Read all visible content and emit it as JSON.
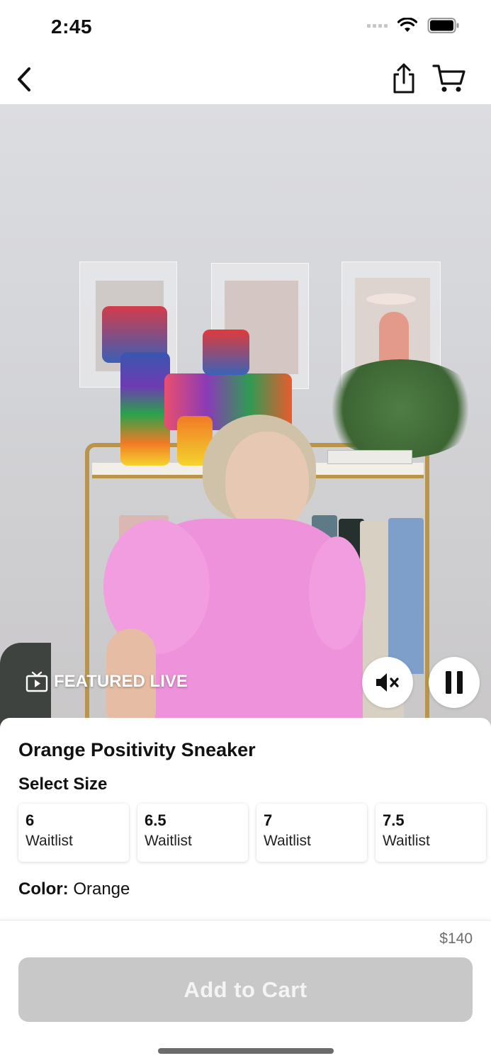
{
  "status_bar": {
    "time": "2:45",
    "icons": [
      "signal-icon",
      "wifi-icon",
      "battery-icon"
    ]
  },
  "nav": {
    "icons": [
      "back-chevron-icon",
      "share-icon",
      "cart-icon"
    ]
  },
  "video": {
    "badge_label": "FEATURED LIVE",
    "badge_icon": "tv-icon",
    "controls": [
      "mute-icon",
      "pause-icon"
    ]
  },
  "product": {
    "title": "Orange Positivity Sneaker",
    "select_size_label": "Select Size",
    "sizes": [
      {
        "size": "6",
        "status": "Waitlist"
      },
      {
        "size": "6.5",
        "status": "Waitlist"
      },
      {
        "size": "7",
        "status": "Waitlist"
      },
      {
        "size": "7.5",
        "status": "Waitlist"
      }
    ],
    "color_label": "Color:",
    "color_value": "Orange"
  },
  "footer": {
    "price": "$140",
    "add_to_cart_label": "Add to Cart"
  },
  "colors": {
    "button_disabled": "#c8c8c8",
    "dress_pink": "#ef92dc",
    "rack_gold": "#b8954a"
  }
}
